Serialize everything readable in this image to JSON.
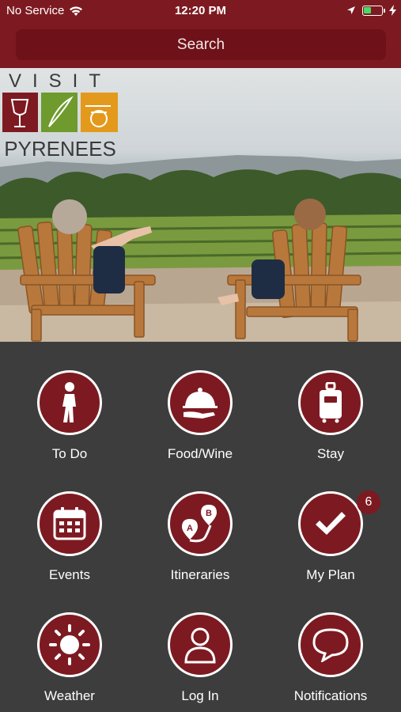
{
  "status_bar": {
    "carrier": "No Service",
    "time": "12:20 PM",
    "battery_level": 0.45,
    "battery_color": "#4cd964"
  },
  "header": {
    "search_label": "Search",
    "bar_color": "#7d1a21"
  },
  "hero": {
    "logo_top": "VISIT",
    "logo_bottom": "PYRENEES"
  },
  "menu": {
    "items": [
      {
        "label": "To Do",
        "icon": "walking-person-icon"
      },
      {
        "label": "Food/Wine",
        "icon": "serving-cloche-icon"
      },
      {
        "label": "Stay",
        "icon": "luggage-icon"
      },
      {
        "label": "Events",
        "icon": "calendar-icon"
      },
      {
        "label": "Itineraries",
        "icon": "route-pins-icon"
      },
      {
        "label": "My Plan",
        "icon": "checkmark-icon",
        "badge": "6"
      },
      {
        "label": "Weather",
        "icon": "sun-icon"
      },
      {
        "label": "Log In",
        "icon": "person-icon"
      },
      {
        "label": "Notifications",
        "icon": "chat-bubble-icon"
      }
    ]
  },
  "colors": {
    "accent": "#7d1a21",
    "background": "#3d3d3d"
  }
}
